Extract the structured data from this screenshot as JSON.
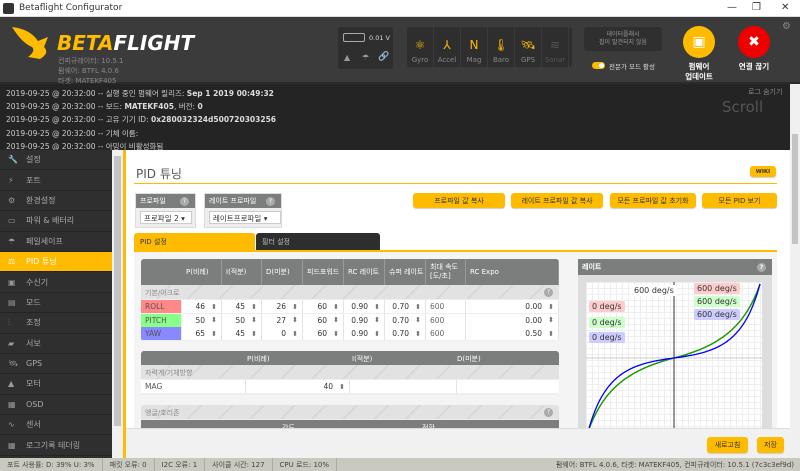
{
  "window": {
    "title": "Betaflight Configurator",
    "minimize": "—",
    "restore": "❐",
    "close": "✕"
  },
  "header": {
    "logo_a": "BETA",
    "logo_b": "FLIGHT",
    "configurator_version": "컨피규레이터: 10.5.1",
    "firmware_version": "펌웨어: BTFL 4.0.6",
    "target": "타겟: MATEKF405",
    "battery_voltage": "0.01 V",
    "sensors": [
      {
        "label": "Gyro",
        "icon": "gyro-icon",
        "glyph": "⚛"
      },
      {
        "label": "Accel",
        "icon": "accel-icon",
        "glyph": "⅄"
      },
      {
        "label": "Mag",
        "icon": "mag-icon",
        "glyph": "N"
      },
      {
        "label": "Baro",
        "icon": "baro-icon",
        "glyph": "🌡"
      },
      {
        "label": "GPS",
        "icon": "gps-icon",
        "glyph": "🛰"
      },
      {
        "label": "Sonar",
        "icon": "sonar-icon",
        "glyph": "≋"
      }
    ],
    "dataflash": "데이터플래시\n칩이 발견되지 않음",
    "expert_mode": "전문가 모드 활성",
    "firmware_update": "펌웨어\n업데이트",
    "disconnect": "연결 끊기"
  },
  "log": {
    "hide": "로그 숨기기",
    "scroll": "Scroll",
    "lines": [
      {
        "prefix": "2019-09-25 @ 20:32:00 -- 실행 중인 펌웨어 릴리즈: ",
        "bold": "Sep 1 2019 00:49:32",
        "suffix": ""
      },
      {
        "prefix": "2019-09-25 @ 20:32:00 -- 보드: ",
        "bold": "MATEKF405",
        "suffix": ", 버전: ",
        "bold2": "0"
      },
      {
        "prefix": "2019-09-25 @ 20:32:00 -- 고유 기기 ID: ",
        "bold": "0x280032324d500720303256",
        "suffix": ""
      },
      {
        "prefix": "2019-09-25 @ 20:32:00 -- 기체 이름:",
        "bold": "",
        "suffix": ""
      },
      {
        "prefix": "2019-09-25 @ 20:32:00 -- 아밍이 비활성화됨",
        "bold": "",
        "suffix": ""
      }
    ]
  },
  "sidebar": {
    "items": [
      {
        "label": "설정",
        "glyph": "🔧",
        "icon": "wrench-icon"
      },
      {
        "label": "포트",
        "glyph": "⚡",
        "icon": "plug-icon"
      },
      {
        "label": "환경설정",
        "glyph": "⚙",
        "icon": "gear-icon"
      },
      {
        "label": "파워 & 배터리",
        "glyph": "▭",
        "icon": "battery-icon"
      },
      {
        "label": "페일세이프",
        "glyph": "☂",
        "icon": "parachute-icon"
      },
      {
        "label": "PID 튜닝",
        "glyph": "⚖",
        "icon": "pid-icon",
        "active": true
      },
      {
        "label": "수신기",
        "glyph": "▣",
        "icon": "receiver-icon"
      },
      {
        "label": "모드",
        "glyph": "▤",
        "icon": "modes-icon"
      },
      {
        "label": "조정",
        "glyph": "⫶",
        "icon": "adjustments-icon"
      },
      {
        "label": "서보",
        "glyph": "▰",
        "icon": "servo-icon"
      },
      {
        "label": "GPS",
        "glyph": "🛰",
        "icon": "gps-icon"
      },
      {
        "label": "모터",
        "glyph": "▲",
        "icon": "motor-icon"
      },
      {
        "label": "OSD",
        "glyph": "▦",
        "icon": "osd-icon"
      },
      {
        "label": "센서",
        "glyph": "∿",
        "icon": "sensors-icon"
      },
      {
        "label": "로그기록 테더링",
        "glyph": "▦",
        "icon": "logging-icon"
      }
    ]
  },
  "page": {
    "title": "PID 튜닝",
    "wiki": "WIKI",
    "profile_label": "프로파일",
    "profile_value": "프로파일 2",
    "rate_profile_label": "레이트 프로파일",
    "rate_profile_value": "레이트프로파일",
    "help": "?",
    "buttons": [
      "프로파일 값 복사",
      "레이트 프로파일 값 복사",
      "모든 프로파일 값 초기화",
      "모든 PID 보기"
    ],
    "tabs": [
      "PID 설정",
      "필터 설정"
    ],
    "pid_table": {
      "headers": [
        "P(비례)",
        "I(적분)",
        "D(미분)",
        "피드포워드",
        "RC 레이트",
        "슈퍼 레이트",
        "최대 속도\n[도/초]",
        "RC Expo"
      ],
      "section": "기본/아크로",
      "rows": [
        {
          "name": "ROLL",
          "color": "#f88",
          "values": [
            "46",
            "45",
            "26",
            "60",
            "0.90",
            "0.70",
            "600",
            "0.00"
          ]
        },
        {
          "name": "PITCH",
          "color": "#8f8",
          "values": [
            "50",
            "50",
            "27",
            "60",
            "0.90",
            "0.70",
            "600",
            "0.00"
          ]
        },
        {
          "name": "YAW",
          "color": "#88f",
          "values": [
            "65",
            "45",
            "0",
            "60",
            "0.90",
            "0.70",
            "600",
            "0.50"
          ]
        }
      ]
    },
    "mag_table": {
      "headers": [
        "P(비례)",
        "I(적분)",
        "D(미분)"
      ],
      "section": "자력계/기체방향",
      "row_name": "MAG",
      "p_value": "40"
    },
    "angle_table": {
      "section": "앵글/호리존",
      "headers": [
        "강도",
        "전환"
      ]
    },
    "rates": {
      "title": "레이트",
      "max_label": "600 deg/s",
      "current": [
        "0 deg/s",
        "0 deg/s",
        "0 deg/s"
      ],
      "max": [
        "600 deg/s",
        "600 deg/s",
        "600 deg/s"
      ]
    },
    "refresh": "새로고침",
    "save": "저장"
  },
  "status": {
    "port": "포트 사용률: D: 39% U: 3%",
    "packet": "패킷 오류: 0",
    "i2c": "I2C 오류: 1",
    "cycle": "사이클 시간: 127",
    "cpu": "CPU 로드: 10%",
    "version": "펌웨어: BTFL 4.0.6, 타겟: MATEKF405, 컨피규레이터: 10.5.1 (7c3c3ef9d)"
  },
  "colors": {
    "accent": "#ffbb00",
    "roll": "#ff0000",
    "pitch": "#00aa00",
    "yaw": "#0000ff"
  }
}
